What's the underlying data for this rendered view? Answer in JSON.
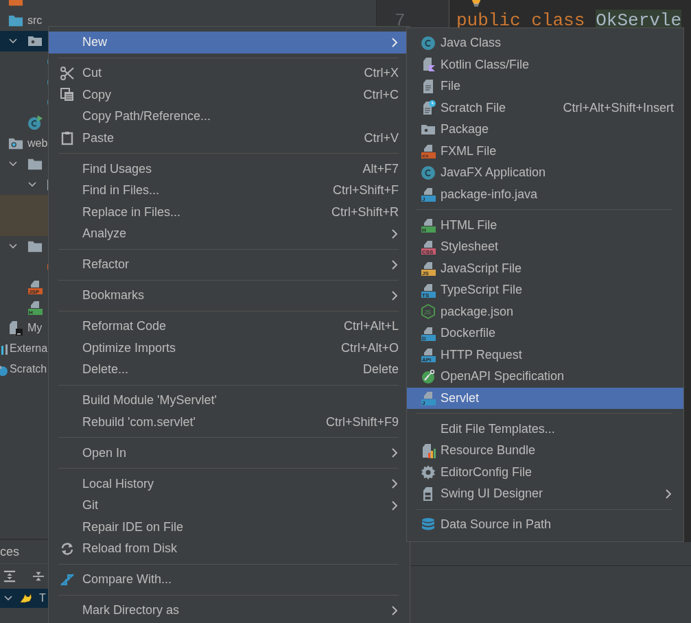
{
  "project_tree": [
    {
      "children": [
        {
          "kind": "excluded-folder",
          "selected": false
        },
        {
          "kind": "source-folder",
          "label": "src",
          "selected": false,
          "children": [
            {
              "kind": "package",
              "expanded": true,
              "selected": true,
              "children": [
                {
                  "kind": "class",
                  "selected": false
                },
                {
                  "kind": "class",
                  "selected": false
                },
                {
                  "kind": "class",
                  "selected": false
                }
              ]
            },
            {
              "kind": "run-class",
              "selected": false
            }
          ]
        },
        {
          "kind": "web-folder",
          "label": "web",
          "selected": false,
          "children": [
            {
              "kind": "folder",
              "expanded": true,
              "selected": false,
              "children": [
                {
                  "kind": "folder",
                  "expanded": true,
                  "selected": false,
                  "children": [
                    {
                      "kind": "blank",
                      "highlighted": true,
                      "selected": false
                    },
                    {
                      "kind": "blank",
                      "highlighted": true,
                      "selected": false
                    }
                  ]
                }
              ]
            },
            {
              "kind": "folder",
              "expanded": true,
              "selected": false,
              "children": [
                {
                  "kind": "xml",
                  "selected": false
                }
              ]
            },
            {
              "kind": "jsp",
              "badge": "JSP",
              "color": "#cc5a28",
              "selected": false
            },
            {
              "kind": "html",
              "badge": "H",
              "color": "#499c54",
              "selected": false
            }
          ]
        },
        {
          "kind": "module",
          "label": "My",
          "selected": false
        }
      ]
    },
    {
      "kind": "library",
      "label": "Externa",
      "selected": false
    },
    {
      "kind": "scratches",
      "label": "Scratch",
      "selected": false
    }
  ],
  "services": {
    "title": "ces",
    "tree": [
      {
        "label": "T",
        "expanded": true,
        "selected": true
      }
    ]
  },
  "editor": {
    "line_number": "7",
    "code": [
      {
        "kind": "keyword",
        "text": "public class"
      },
      {
        "kind": "identifier",
        "text": "OkServle"
      }
    ]
  },
  "context_menu": [
    [
      {
        "label": "New",
        "submenu": true,
        "selected": true
      }
    ],
    [
      {
        "label": "Cut",
        "shortcut": "Ctrl+X",
        "submenu": false,
        "selected": false
      },
      {
        "label": "Copy",
        "shortcut": "Ctrl+C",
        "submenu": false,
        "selected": false
      },
      {
        "label": "Copy Path/Reference...",
        "submenu": false,
        "selected": false
      },
      {
        "label": "Paste",
        "shortcut": "Ctrl+V",
        "submenu": false,
        "selected": false
      }
    ],
    [
      {
        "label": "Find Usages",
        "shortcut": "Alt+F7",
        "submenu": false,
        "selected": false
      },
      {
        "label": "Find in Files...",
        "shortcut": "Ctrl+Shift+F",
        "submenu": false,
        "selected": false
      },
      {
        "label": "Replace in Files...",
        "shortcut": "Ctrl+Shift+R",
        "submenu": false,
        "selected": false
      },
      {
        "label": "Analyze",
        "submenu": true,
        "selected": false
      }
    ],
    [
      {
        "label": "Refactor",
        "submenu": true,
        "selected": false
      }
    ],
    [
      {
        "label": "Bookmarks",
        "submenu": true,
        "selected": false
      }
    ],
    [
      {
        "label": "Reformat Code",
        "shortcut": "Ctrl+Alt+L",
        "submenu": false,
        "selected": false
      },
      {
        "label": "Optimize Imports",
        "shortcut": "Ctrl+Alt+O",
        "submenu": false,
        "selected": false
      },
      {
        "label": "Delete...",
        "shortcut": "Delete",
        "submenu": false,
        "selected": false
      }
    ],
    [
      {
        "label": "Build Module 'MyServlet'",
        "submenu": false,
        "selected": false
      },
      {
        "label": "Rebuild 'com.servlet'",
        "shortcut": "Ctrl+Shift+F9",
        "submenu": false,
        "selected": false
      }
    ],
    [
      {
        "label": "Open In",
        "submenu": true,
        "selected": false
      }
    ],
    [
      {
        "label": "Local History",
        "submenu": true,
        "selected": false
      },
      {
        "label": "Git",
        "submenu": true,
        "selected": false
      },
      {
        "label": "Repair IDE on File",
        "submenu": false,
        "selected": false
      },
      {
        "label": "Reload from Disk",
        "submenu": false,
        "selected": false
      }
    ],
    [
      {
        "label": "Compare With...",
        "submenu": false,
        "selected": false
      }
    ],
    [
      {
        "label": "Mark Directory as",
        "submenu": true,
        "selected": false
      }
    ]
  ],
  "new_submenu": [
    [
      {
        "label": "Java Class",
        "submenu": false,
        "selected": false
      },
      {
        "label": "Kotlin Class/File",
        "submenu": false,
        "selected": false
      },
      {
        "label": "File",
        "submenu": false,
        "selected": false
      },
      {
        "label": "Scratch File",
        "shortcut": "Ctrl+Alt+Shift+Insert",
        "submenu": false,
        "selected": false
      },
      {
        "label": "Package",
        "submenu": false,
        "selected": false
      },
      {
        "label": "FXML File",
        "badge": "<>",
        "color": "#cc5a28",
        "submenu": false,
        "selected": false
      },
      {
        "label": "JavaFX Application",
        "submenu": false,
        "selected": false
      },
      {
        "label": "package-info.java",
        "badge": "J",
        "color": "#3592c4",
        "submenu": false,
        "selected": false
      }
    ],
    [
      {
        "label": "HTML File",
        "badge": "H",
        "color": "#499c54",
        "submenu": false,
        "selected": false
      },
      {
        "label": "Stylesheet",
        "badge": "CSS",
        "color": "#c75c70",
        "submenu": false,
        "selected": false
      },
      {
        "label": "JavaScript File",
        "badge": "JS",
        "color": "#d9a343",
        "submenu": false,
        "selected": false
      },
      {
        "label": "TypeScript File",
        "badge": "TS",
        "color": "#3592c4",
        "submenu": false,
        "selected": false
      },
      {
        "label": "package.json",
        "badge": "JS",
        "color": "#4f9b50",
        "submenu": false,
        "selected": false
      },
      {
        "label": "Dockerfile",
        "badge": "D",
        "color": "#3592c4",
        "submenu": false,
        "selected": false
      },
      {
        "label": "HTTP Request",
        "badge": "API",
        "color": "#3592c4",
        "submenu": false,
        "selected": false
      },
      {
        "label": "OpenAPI Specification",
        "submenu": false,
        "selected": false
      },
      {
        "label": "Servlet",
        "badge": "J",
        "color": "#3592c4",
        "submenu": false,
        "selected": true
      }
    ],
    [
      {
        "label": "Edit File Templates...",
        "submenu": false,
        "selected": false
      },
      {
        "label": "Resource Bundle",
        "submenu": false,
        "selected": false
      },
      {
        "label": "EditorConfig File",
        "submenu": false,
        "selected": false
      },
      {
        "label": "Swing UI Designer",
        "submenu": true,
        "selected": false
      }
    ],
    [
      {
        "label": "Data Source in Path",
        "submenu": false,
        "selected": false
      }
    ]
  ]
}
